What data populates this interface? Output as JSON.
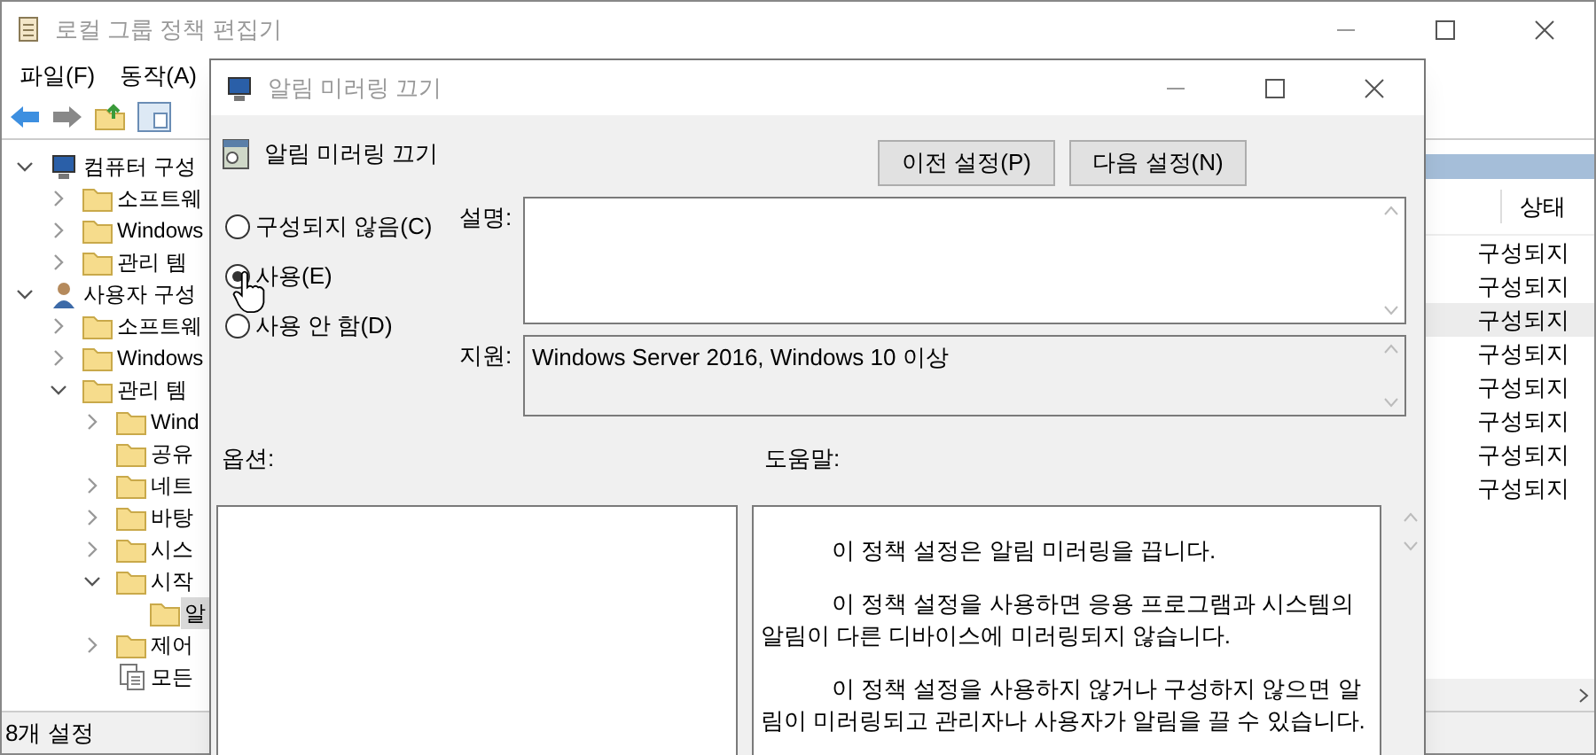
{
  "window": {
    "title": "로컬 그룹 정책 편집기"
  },
  "menu": [
    "파일(F)",
    "동작(A)"
  ],
  "tree": [
    {
      "label": "컴퓨터 구성",
      "kind": "computer",
      "expanded": true,
      "children": [
        {
          "label": "소프트웨",
          "kind": "folder",
          "expanded": false
        },
        {
          "label": "Windows",
          "kind": "folder",
          "expanded": false
        },
        {
          "label": "관리 템",
          "kind": "folder",
          "expanded": false
        }
      ]
    },
    {
      "label": "사용자 구성",
      "kind": "user",
      "expanded": true,
      "children": [
        {
          "label": "소프트웨",
          "kind": "folder",
          "expanded": false
        },
        {
          "label": "Windows",
          "kind": "folder",
          "expanded": false
        },
        {
          "label": "관리 템",
          "kind": "folder",
          "expanded": true,
          "children": [
            {
              "label": "Wind",
              "kind": "folder",
              "expanded": false
            },
            {
              "label": "공유",
              "kind": "leaf"
            },
            {
              "label": "네트",
              "kind": "folder",
              "expanded": false
            },
            {
              "label": "바탕",
              "kind": "folder",
              "expanded": false
            },
            {
              "label": "시스",
              "kind": "folder",
              "expanded": false
            },
            {
              "label": "시작",
              "kind": "folder",
              "expanded": true,
              "children": [
                {
                  "label": "알",
                  "kind": "leaf",
                  "selected": true
                }
              ]
            },
            {
              "label": "제어",
              "kind": "folder",
              "expanded": false
            },
            {
              "label": "모든",
              "kind": "settings"
            }
          ]
        }
      ]
    }
  ],
  "list": {
    "column": "상태",
    "rows": [
      {
        "status": "구성되지",
        "selected": false
      },
      {
        "status": "구성되지",
        "selected": false
      },
      {
        "status": "구성되지",
        "selected": true
      },
      {
        "status": "구성되지",
        "selected": false
      },
      {
        "status": "구성되지",
        "selected": false
      },
      {
        "status": "구성되지",
        "selected": false
      },
      {
        "status": "구성되지",
        "selected": false
      },
      {
        "status": "구성되지",
        "selected": false
      }
    ]
  },
  "status_bar": "8개 설정",
  "dialog": {
    "title": "알림 미러링 끄기",
    "heading": "알림 미러링 끄기",
    "buttons": [
      "이전 설정(P)",
      "다음 설정(N)"
    ],
    "options": [
      {
        "label": "구성되지 않음(C)",
        "selected": false
      },
      {
        "label": "사용(E)",
        "selected": true
      },
      {
        "label": "사용 안 함(D)",
        "selected": false
      }
    ],
    "comment_label": "설명:",
    "support_label": "지원:",
    "support": "Windows Server 2016, Windows 10 이상",
    "options_label": "옵션:",
    "help_label": "도움말:",
    "help": [
      "이 정책 설정은 알림 미러링을 끕니다.",
      "이 정책 설정을 사용하면 응용 프로그램과 시스템의 알림이 다른 디바이스에 미러링되지 않습니다.",
      "이 정책 설정을 사용하지 않거나 구성하지 않으면 알림이 미러링되고 관리자나 사용자가 알림을 끌 수 있습니다."
    ]
  }
}
